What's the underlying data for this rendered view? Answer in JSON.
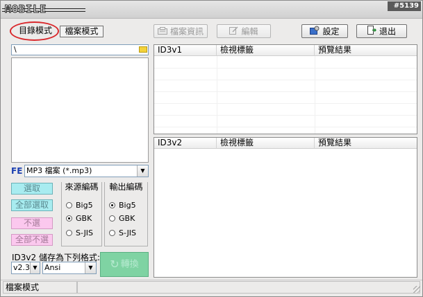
{
  "app": {
    "logo_text": "MOBILE",
    "build_badge": "#5139"
  },
  "mode_tabs": {
    "directory": "目錄模式",
    "file": "檔案模式"
  },
  "toolbar": {
    "file_info_label": "檔案資訊",
    "edit_label": "編輯",
    "settings_label": "設定",
    "exit_label": "退出"
  },
  "path": {
    "value": "\\"
  },
  "filter": {
    "fe_label": "FE",
    "selected": "MP3 檔案 (*.mp3)"
  },
  "select_buttons": {
    "select": "選取",
    "select_all": "全部選取",
    "deselect": "不選",
    "deselect_all": "全部不選"
  },
  "source_encoding": {
    "title": "來源編碼",
    "options": [
      "Big5",
      "GBK",
      "S-JIS"
    ],
    "selected": "GBK"
  },
  "output_encoding": {
    "title": "輸出編碼",
    "options": [
      "Big5",
      "GBK",
      "S-JIS"
    ],
    "selected": "Big5"
  },
  "save_format": {
    "label": "ID3v2 儲存為下列格式:",
    "version": "v2.3",
    "encoding": "Ansi"
  },
  "convert_label": "轉換",
  "table_id3v1": {
    "columns": [
      "ID3v1",
      "檢視標籤",
      "預覽結果"
    ]
  },
  "table_id3v2": {
    "columns": [
      "ID3v2",
      "檢視標籤",
      "預覽結果"
    ]
  },
  "status": {
    "mode": "檔案模式",
    "message": ""
  },
  "colors": {
    "select_cyan": "#a8ecf0",
    "select_pink": "#fbc8ee",
    "convert_green": "#7fd3a3",
    "highlight_red": "#d9282c"
  }
}
